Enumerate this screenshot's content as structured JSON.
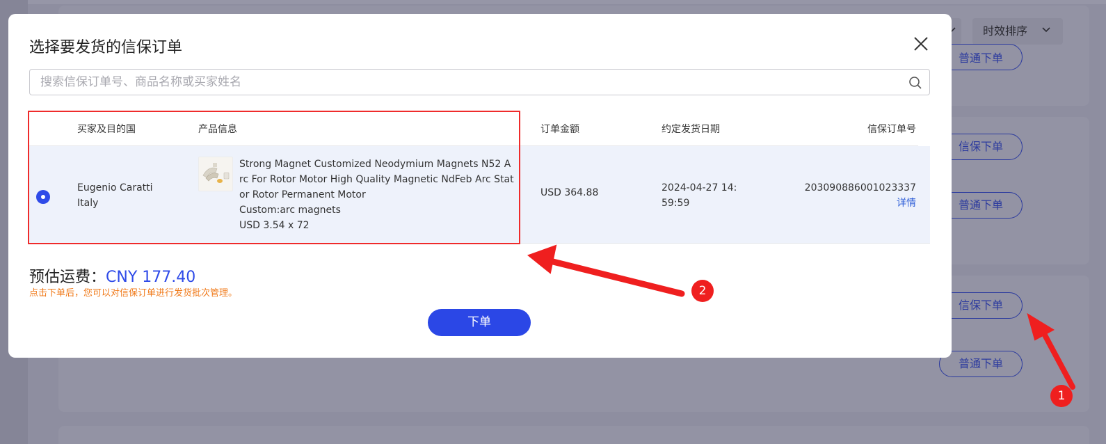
{
  "background": {
    "sort_label": "时效排序",
    "buttons": [
      "普通下单",
      "信保下单",
      "普通下单",
      "信保下单",
      "普通下单"
    ]
  },
  "modal": {
    "title": "选择要发货的信保订单",
    "search": {
      "placeholder": "搜索信保订单号、商品名称或买家姓名",
      "value": ""
    },
    "table": {
      "headers": {
        "buyer": "买家及目的国",
        "product": "产品信息",
        "amount": "订单金额",
        "date": "约定发货日期",
        "order_no": "信保订单号"
      },
      "rows": [
        {
          "selected": true,
          "buyer_name": "Eugenio Caratti",
          "buyer_country": "Italy",
          "product_title": "Strong Magnet Customized Neodymium Magnets N52 Arc For Rotor Motor High Quality Magnetic NdFeb Arc Stator Rotor Permanent Motor",
          "product_custom": "Custom:arc magnets",
          "product_price": "USD 3.54 x 72",
          "amount": "USD 364.88",
          "date": "2024-04-27 14:59:59",
          "order_no": "203090886001023337",
          "detail_label": "详情"
        }
      ]
    },
    "fee_label": "预估运费：",
    "fee_value": "CNY 177.40",
    "fee_note": "点击下单后，您可以对信保订单进行发货批次管理。",
    "order_button": "下单"
  },
  "annotations": {
    "badge_1": "1",
    "badge_2": "2",
    "color": "#ef1f1f"
  }
}
